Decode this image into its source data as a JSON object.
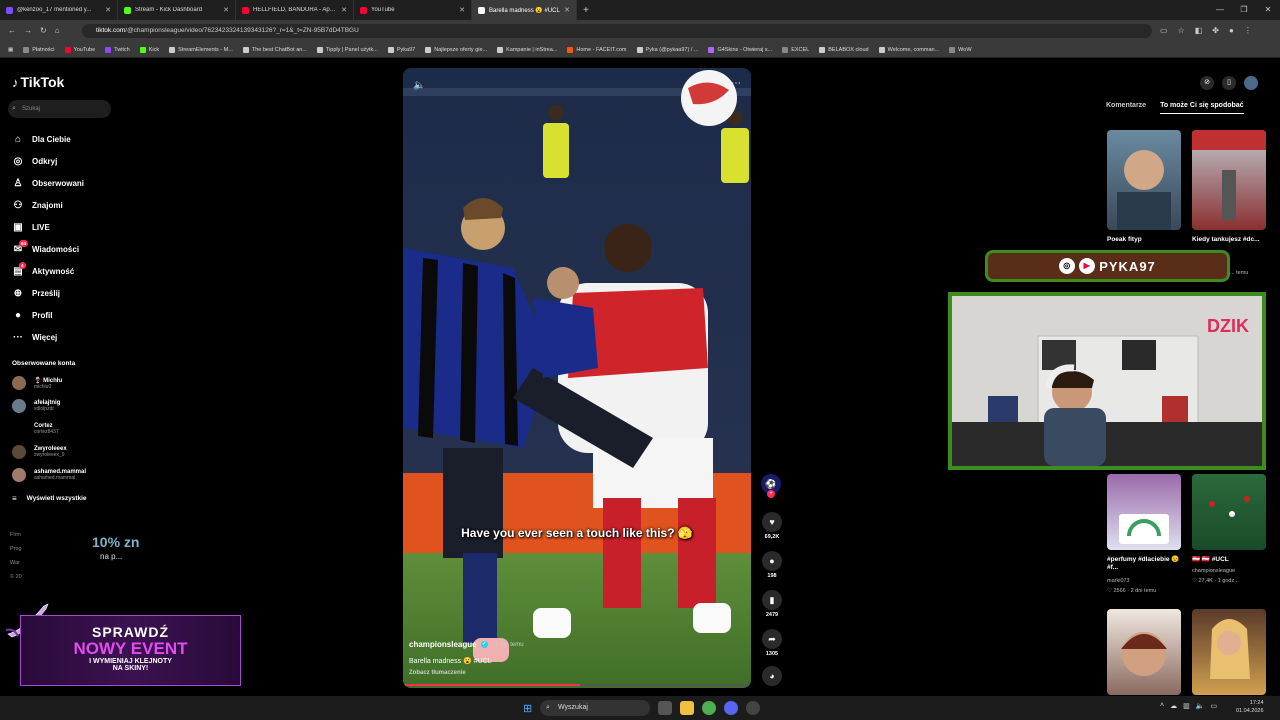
{
  "browser": {
    "tabs": [
      {
        "label": "@kenzoo_17 mentioned y...",
        "color": "#7c4dff"
      },
      {
        "label": "Stream - Kick Dashboard",
        "color": "#53fc18"
      },
      {
        "label": "HELLFIELD, BANDURA - Aparta...",
        "color": "#ff0033"
      },
      {
        "label": "YouTube",
        "color": "#ff0033"
      },
      {
        "label": "Barella madness 😮 #UCL",
        "color": "#ffffff"
      }
    ],
    "url_host": "tiktok.com",
    "url_path": "/@championsleague/video/7623423324139343126?_r=1&_t=ZN-95B7dD4TBGU",
    "bookmarks": [
      {
        "label": "Płatności",
        "color": "#888888"
      },
      {
        "label": "YouTube",
        "color": "#ff0033"
      },
      {
        "label": "Twitch",
        "color": "#9146ff"
      },
      {
        "label": "Kick",
        "color": "#53fc18"
      },
      {
        "label": "StreamElements - M...",
        "color": "#cccccc"
      },
      {
        "label": "The best ChatBot an...",
        "color": "#cccccc"
      },
      {
        "label": "Tipply | Panel użytk...",
        "color": "#cccccc"
      },
      {
        "label": "Pyka97",
        "color": "#cccccc"
      },
      {
        "label": "Najlepsze oferty gie...",
        "color": "#cccccc"
      },
      {
        "label": "Kampanie | inStrea...",
        "color": "#cccccc"
      },
      {
        "label": "Home - FACEIT.com",
        "color": "#ff5500"
      },
      {
        "label": "Pyka (@pykaa97) / ...",
        "color": "#cccccc"
      },
      {
        "label": "G4Skins - Otwieraj s...",
        "color": "#b266ff"
      },
      {
        "label": "EXCEL",
        "color": "#888888"
      },
      {
        "label": "BELABOX cloud",
        "color": "#cccccc"
      },
      {
        "label": "Welcome, comman...",
        "color": "#cccccc"
      },
      {
        "label": "WoW",
        "color": "#888888"
      }
    ]
  },
  "sidebar": {
    "logo": "TikTok",
    "search_placeholder": "Szukaj",
    "nav": [
      {
        "label": "Dla Ciebie",
        "icon": "home-icon",
        "glyph": "⌂"
      },
      {
        "label": "Odkryj",
        "icon": "compass-icon",
        "glyph": "◎"
      },
      {
        "label": "Obserwowani",
        "icon": "following-icon",
        "glyph": "♙"
      },
      {
        "label": "Znajomi",
        "icon": "friends-icon",
        "glyph": "⚇"
      },
      {
        "label": "LIVE",
        "icon": "live-icon",
        "glyph": "▣"
      },
      {
        "label": "Wiadomości",
        "icon": "messages-icon",
        "glyph": "✉",
        "badge": "64"
      },
      {
        "label": "Aktywność",
        "icon": "activity-icon",
        "glyph": "▤",
        "badge": "4"
      },
      {
        "label": "Prześlij",
        "icon": "upload-icon",
        "glyph": "⊕"
      },
      {
        "label": "Profil",
        "icon": "profile-icon",
        "glyph": "●"
      },
      {
        "label": "Więcej",
        "icon": "more-icon",
        "glyph": "···"
      }
    ],
    "following_title": "Obserwowane konta",
    "accounts": [
      {
        "name": "🍷 Michłu",
        "handle": "michlu0",
        "color": "#8a6a50"
      },
      {
        "name": "afelajtnig",
        "handle": "xdlolpzdr",
        "color": "#6a7a8a"
      },
      {
        "name": "Cortez",
        "handle": "cortez8437",
        "color": "#000000"
      },
      {
        "name": "Zwyroleeex",
        "handle": "zwyroleeex_9",
        "color": "#5a4a3a"
      },
      {
        "name": "ashamed.mammal",
        "handle": "ashamed.mammal",
        "color": "#a07a6a"
      }
    ],
    "see_all": "Wyświetl wszystkie",
    "footer": [
      "Firm",
      "Prog",
      "War",
      "© 20"
    ],
    "promo_pct": "10% zn",
    "promo_sub": "na p..."
  },
  "event_banner": {
    "line1": "SPRAWDŹ",
    "line2": "NOWY EVENT",
    "line3": "I WYMIENIAJ KLEJNOTY",
    "line4": "NA SKINY!"
  },
  "video": {
    "caption": "Have you ever seen a touch like this? 🫣",
    "author": "championsleague",
    "time": "· 1 dn. temu",
    "description": "Barella madness 😮 #UCL",
    "translate": "Zobacz tłumaczenie",
    "progress": 0.51
  },
  "actions": [
    {
      "icon": "heart-icon",
      "glyph": "♥",
      "count": "69,2K"
    },
    {
      "icon": "comment-icon",
      "glyph": "●",
      "count": "198"
    },
    {
      "icon": "bookmark-icon",
      "glyph": "▮",
      "count": "2479"
    },
    {
      "icon": "share-icon",
      "glyph": "➦",
      "count": "1305"
    }
  ],
  "right_panel": {
    "tab_comments": "Komentarze",
    "tab_recommended": "To może Ci się spodobać",
    "videos": [
      {
        "title": "Poeak fityp",
        "sub": "",
        "color1": "#6a8aa0",
        "color2": "#3a4a5a"
      },
      {
        "title": "Kiedy tankujesz #dc...",
        "sub": "... temu",
        "color1": "#c0c8d0",
        "color2": "#8a3030"
      },
      {
        "title": "#perfumy #dlaciebie 😉 #f...",
        "sub": "marki073",
        "stats": "♡ 2566 · 2 dni temu",
        "color1": "#e0e0f0",
        "color2": "#5a8ad0"
      },
      {
        "title": "🇦🇹 🇦🇹 #UCL",
        "sub": "championsleague",
        "stats": "♡ 27,4K · 1 godz...",
        "color1": "#2a6a3a",
        "color2": "#1a4a2a"
      },
      {
        "title": "",
        "sub": "",
        "color1": "#8a6a60",
        "color2": "#3a2a2a"
      },
      {
        "title": "",
        "sub": "",
        "color1": "#d0a050",
        "color2": "#5a3a2a"
      }
    ]
  },
  "overlay": {
    "channel": "PYKA97",
    "logo": "DZIK"
  },
  "taskbar": {
    "search_placeholder": "Wyszukaj",
    "time": "17:24",
    "date": "01.04.2026"
  }
}
